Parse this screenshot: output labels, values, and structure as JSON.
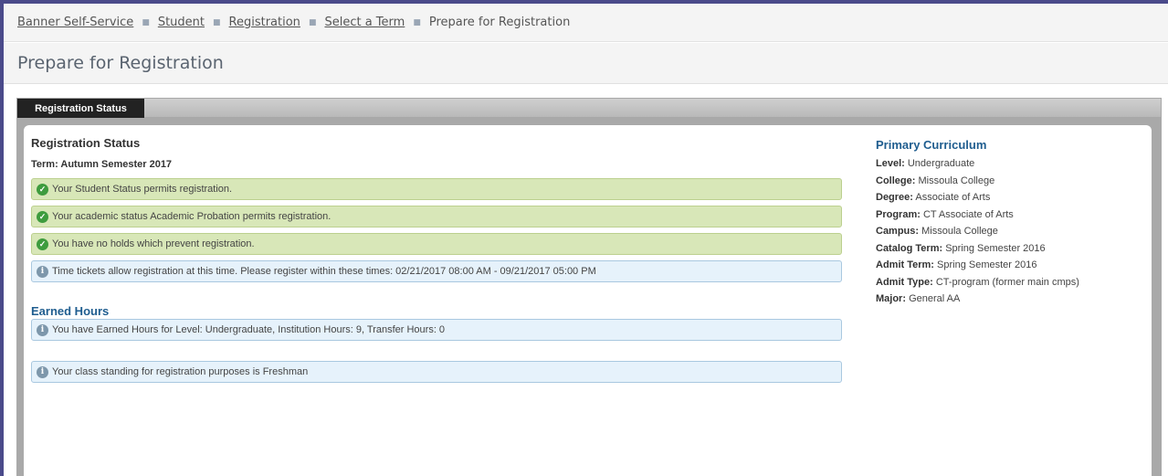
{
  "breadcrumb": {
    "items": [
      "Banner Self-Service",
      "Student",
      "Registration",
      "Select a Term"
    ],
    "current": "Prepare for Registration"
  },
  "page": {
    "title": "Prepare for Registration"
  },
  "tabs": [
    {
      "label": "Registration Status",
      "active": true
    }
  ],
  "registration_status": {
    "heading": "Registration Status",
    "term": "Term: Autumn Semester 2017",
    "messages": [
      {
        "type": "success",
        "text": "Your Student Status permits registration."
      },
      {
        "type": "success",
        "text": "Your academic status Academic Probation permits registration."
      },
      {
        "type": "success",
        "text": "You have no holds which prevent registration."
      },
      {
        "type": "info",
        "text": "Time tickets allow registration at this time. Please register within these times: 02/21/2017 08:00 AM - 09/21/2017 05:00 PM"
      }
    ]
  },
  "earned_hours": {
    "heading": "Earned Hours",
    "messages": [
      {
        "type": "info",
        "text": "You have Earned Hours for Level: Undergraduate, Institution Hours: 9, Transfer Hours: 0"
      },
      {
        "type": "info",
        "text": "Your class standing for registration purposes is Freshman"
      }
    ]
  },
  "primary_curriculum": {
    "heading": "Primary Curriculum",
    "fields": [
      {
        "label": "Level:",
        "value": "Undergraduate"
      },
      {
        "label": "College:",
        "value": "Missoula College"
      },
      {
        "label": "Degree:",
        "value": "Associate of Arts"
      },
      {
        "label": "Program:",
        "value": "CT Associate of Arts"
      },
      {
        "label": "Campus:",
        "value": "Missoula College"
      },
      {
        "label": "Catalog Term:",
        "value": "Spring Semester 2016"
      },
      {
        "label": "Admit Term:",
        "value": "Spring Semester 2016"
      },
      {
        "label": "Admit Type:",
        "value": "CT-program (former main cmps)"
      },
      {
        "label": "Major:",
        "value": "General AA"
      }
    ]
  },
  "colors": {
    "success_bg": "#d8e7b8",
    "info_bg": "#e6f2fb",
    "heading_blue": "#1f5d8f",
    "tab_active": "#222222"
  },
  "icons": {
    "success": "check-circle-icon",
    "info": "info-circle-icon"
  }
}
